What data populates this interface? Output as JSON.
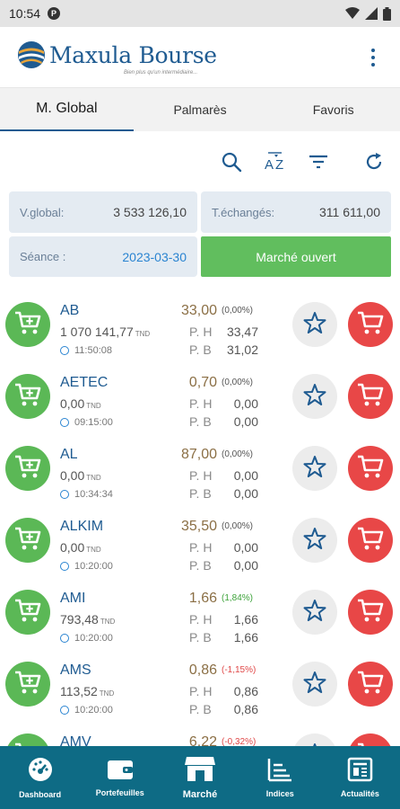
{
  "status_bar": {
    "time": "10:54",
    "notification_glyph": "P"
  },
  "app": {
    "brand": "Maxula Bourse",
    "tagline": "Bien plus qu'un intermédiaire...",
    "accent_color": "#1f5b91",
    "buy_color": "#5bb856",
    "sell_color": "#e84747"
  },
  "tabs": [
    {
      "label": "M. Global",
      "active": true
    },
    {
      "label": "Palmarès",
      "active": false
    },
    {
      "label": "Favoris",
      "active": false
    }
  ],
  "toolbar_icons": [
    "search-icon",
    "sort-az-icon",
    "filter-icon",
    "refresh-icon"
  ],
  "summary": {
    "v_global_label": "V.global:",
    "v_global_value": "3 533 126,10",
    "t_echanges_label": "T.échangés:",
    "t_echanges_value": "311 611,00",
    "seance_label": "Séance :",
    "seance_value": "2023-03-30",
    "market_status": "Marché ouvert"
  },
  "stocks": [
    {
      "symbol": "AB",
      "volume": "1 070 141,77",
      "currency": "TND",
      "time": "11:50:08",
      "price": "33,00",
      "change": "(0,00%)",
      "trend": "flat",
      "ph_label": "P. H",
      "ph": "33,47",
      "pb_label": "P. B",
      "pb": "31,02"
    },
    {
      "symbol": "AETEC",
      "volume": "0,00",
      "currency": "TND",
      "time": "09:15:00",
      "price": "0,70",
      "change": "(0,00%)",
      "trend": "flat",
      "ph_label": "P. H",
      "ph": "0,00",
      "pb_label": "P. B",
      "pb": "0,00"
    },
    {
      "symbol": "AL",
      "volume": "0,00",
      "currency": "TND",
      "time": "10:34:34",
      "price": "87,00",
      "change": "(0,00%)",
      "trend": "flat",
      "ph_label": "P. H",
      "ph": "0,00",
      "pb_label": "P. B",
      "pb": "0,00"
    },
    {
      "symbol": "ALKIM",
      "volume": "0,00",
      "currency": "TND",
      "time": "10:20:00",
      "price": "35,50",
      "change": "(0,00%)",
      "trend": "flat",
      "ph_label": "P. H",
      "ph": "0,00",
      "pb_label": "P. B",
      "pb": "0,00"
    },
    {
      "symbol": "AMI",
      "volume": "793,48",
      "currency": "TND",
      "time": "10:20:00",
      "price": "1,66",
      "change": "(1,84%)",
      "trend": "up",
      "ph_label": "P. H",
      "ph": "1,66",
      "pb_label": "P. B",
      "pb": "1,66"
    },
    {
      "symbol": "AMS",
      "volume": "113,52",
      "currency": "TND",
      "time": "10:20:00",
      "price": "0,86",
      "change": "(-1,15%)",
      "trend": "down",
      "ph_label": "P. H",
      "ph": "0,86",
      "pb_label": "P. B",
      "pb": "0,86"
    },
    {
      "symbol": "AMV",
      "volume": "",
      "currency": "",
      "time": "",
      "price": "6,22",
      "change": "(-0,32%)",
      "trend": "down",
      "ph_label": "",
      "ph": "",
      "pb_label": "",
      "pb": ""
    }
  ],
  "bottom_nav": [
    {
      "label": "Dashboard",
      "icon": "dashboard-icon"
    },
    {
      "label": "Portefeuilles",
      "icon": "wallet-icon"
    },
    {
      "label": "Marché",
      "icon": "market-icon",
      "active": true
    },
    {
      "label": "Indices",
      "icon": "indices-icon"
    },
    {
      "label": "Actualités",
      "icon": "news-icon"
    }
  ]
}
